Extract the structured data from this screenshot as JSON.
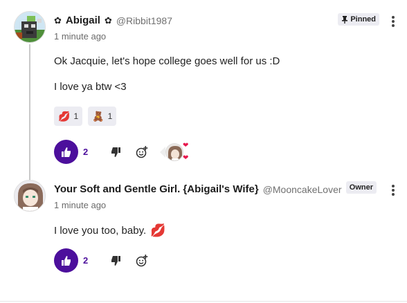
{
  "comments": [
    {
      "author": "Abigail",
      "author_prefix": "✿",
      "author_suffix": "✿",
      "handle": "@Ribbit1987",
      "timestamp": "1 minute ago",
      "badge": "Pinned",
      "lines": [
        "Ok Jacquie, let's hope college goes well for us :D",
        "I love ya btw <3"
      ],
      "reactions": [
        {
          "icon": "lips-icon",
          "count": "1"
        },
        {
          "icon": "teddy-bear-icon",
          "count": "1"
        }
      ],
      "likes": "2"
    },
    {
      "author": "Your Soft and Gentle Girl. {Abigail's Wife}",
      "handle": "@MooncakeLover",
      "timestamp": "1 minute ago",
      "badge": "Owner",
      "lines": [
        "I love you too, baby."
      ],
      "likes": "2"
    }
  ],
  "colors": {
    "accent": "#4c0f9c",
    "heart": "#e8174d",
    "badge_bg": "#ececf2"
  }
}
